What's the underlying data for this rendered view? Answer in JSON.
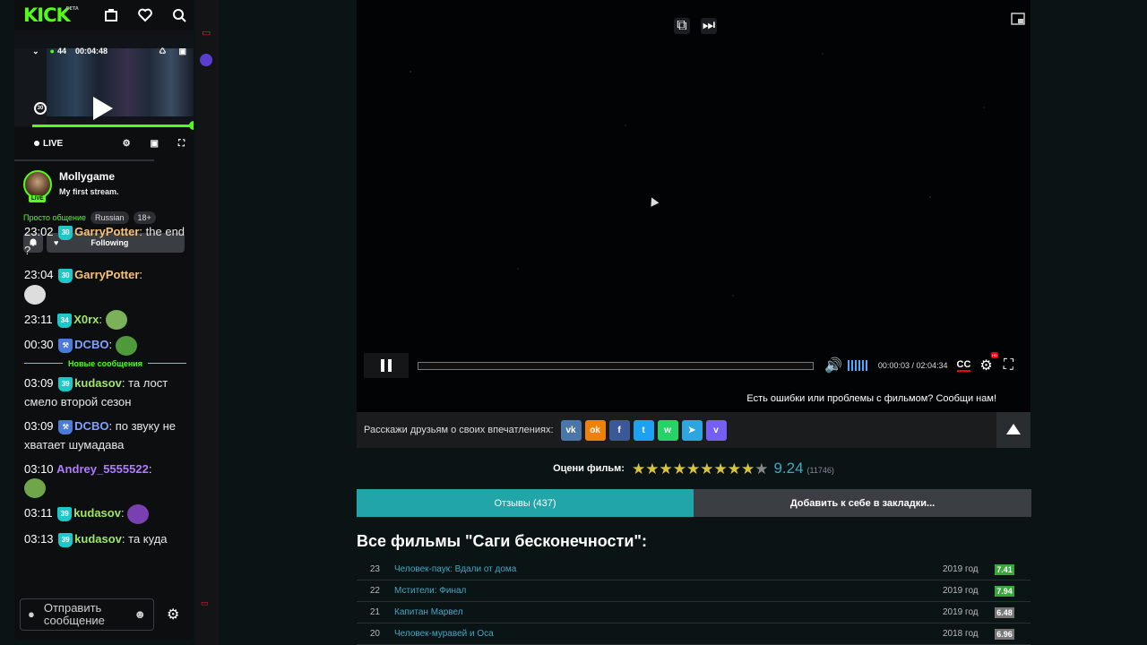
{
  "kick": {
    "logo": "KICK",
    "beta": "BETA",
    "player": {
      "viewers": "44",
      "time": "00:04:48",
      "live": "LIVE",
      "replay": "30"
    },
    "streamer": {
      "name": "Mollygame",
      "title": "My first stream.",
      "live_badge": "LIVE"
    },
    "category": "Просто общение",
    "tags": [
      "Russian",
      "18+"
    ],
    "follow_label": "Following",
    "new_messages": "Новые сообщения",
    "chat_placeholder": "Отправить сообщение",
    "messages": [
      {
        "time": "23:02",
        "badge": "30",
        "user": "GarryPotter",
        "text": "the end ?"
      },
      {
        "time": "23:04",
        "badge": "30",
        "user": "GarryPotter",
        "text": ""
      },
      {
        "time": "23:11",
        "badge": "34",
        "user": "X0rx",
        "text": ""
      },
      {
        "time": "00:30",
        "badge": "",
        "user": "DCBO",
        "text": ""
      },
      {
        "time": "03:09",
        "badge": "39",
        "user": "kudasov",
        "text": "та лост смело второй сезон"
      },
      {
        "time": "03:09",
        "badge": "",
        "user": "DCBO",
        "text": "по звуку не хватает шумадава"
      },
      {
        "time": "03:10",
        "badge": "",
        "user": "Andrey_5555522",
        "text": ""
      },
      {
        "time": "03:11",
        "badge": "39",
        "user": "kudasov",
        "text": ""
      },
      {
        "time": "03:13",
        "badge": "39",
        "user": "kudasov",
        "text": "та куда"
      }
    ]
  },
  "video": {
    "current_time": "00:00:03 / 02:04:34",
    "cc": "CC",
    "hd": "HD",
    "error_text": "Есть ошибки или проблемы с фильмом? Сообщи нам!"
  },
  "share": {
    "label": "Расскажи друзьям о своих впечатлениях:",
    "buttons": [
      {
        "name": "vk",
        "glyph": "vk",
        "color": "#4a76a8"
      },
      {
        "name": "ok",
        "glyph": "ok",
        "color": "#ee8208"
      },
      {
        "name": "facebook",
        "glyph": "f",
        "color": "#3b5998"
      },
      {
        "name": "twitter",
        "glyph": "t",
        "color": "#1da1f2"
      },
      {
        "name": "whatsapp",
        "glyph": "w",
        "color": "#25d366"
      },
      {
        "name": "telegram",
        "glyph": "➤",
        "color": "#2ca5e0"
      },
      {
        "name": "viber",
        "glyph": "v",
        "color": "#7360f2"
      }
    ]
  },
  "rating": {
    "label": "Оцени фильм:",
    "score": "9.24",
    "votes": "(11746)",
    "stars_on": 9,
    "stars_total": 10
  },
  "tabs": {
    "reviews": "Отзывы (437)",
    "bookmark": "Добавить к себе в закладки..."
  },
  "saga": {
    "title": "Все фильмы \"Саги бесконечности\":",
    "films": [
      {
        "num": "23",
        "title": "Человек-паук: Вдали от дома",
        "year": "2019 год",
        "score": "7.41",
        "color": "#3aa53a"
      },
      {
        "num": "22",
        "title": "Мстители: Финал",
        "year": "2019 год",
        "score": "7.94",
        "color": "#3aa53a"
      },
      {
        "num": "21",
        "title": "Капитан Марвел",
        "year": "2019 год",
        "score": "6.48",
        "color": "#777"
      },
      {
        "num": "20",
        "title": "Человек-муравей и Оса",
        "year": "2018 год",
        "score": "6.96",
        "color": "#777"
      }
    ]
  }
}
